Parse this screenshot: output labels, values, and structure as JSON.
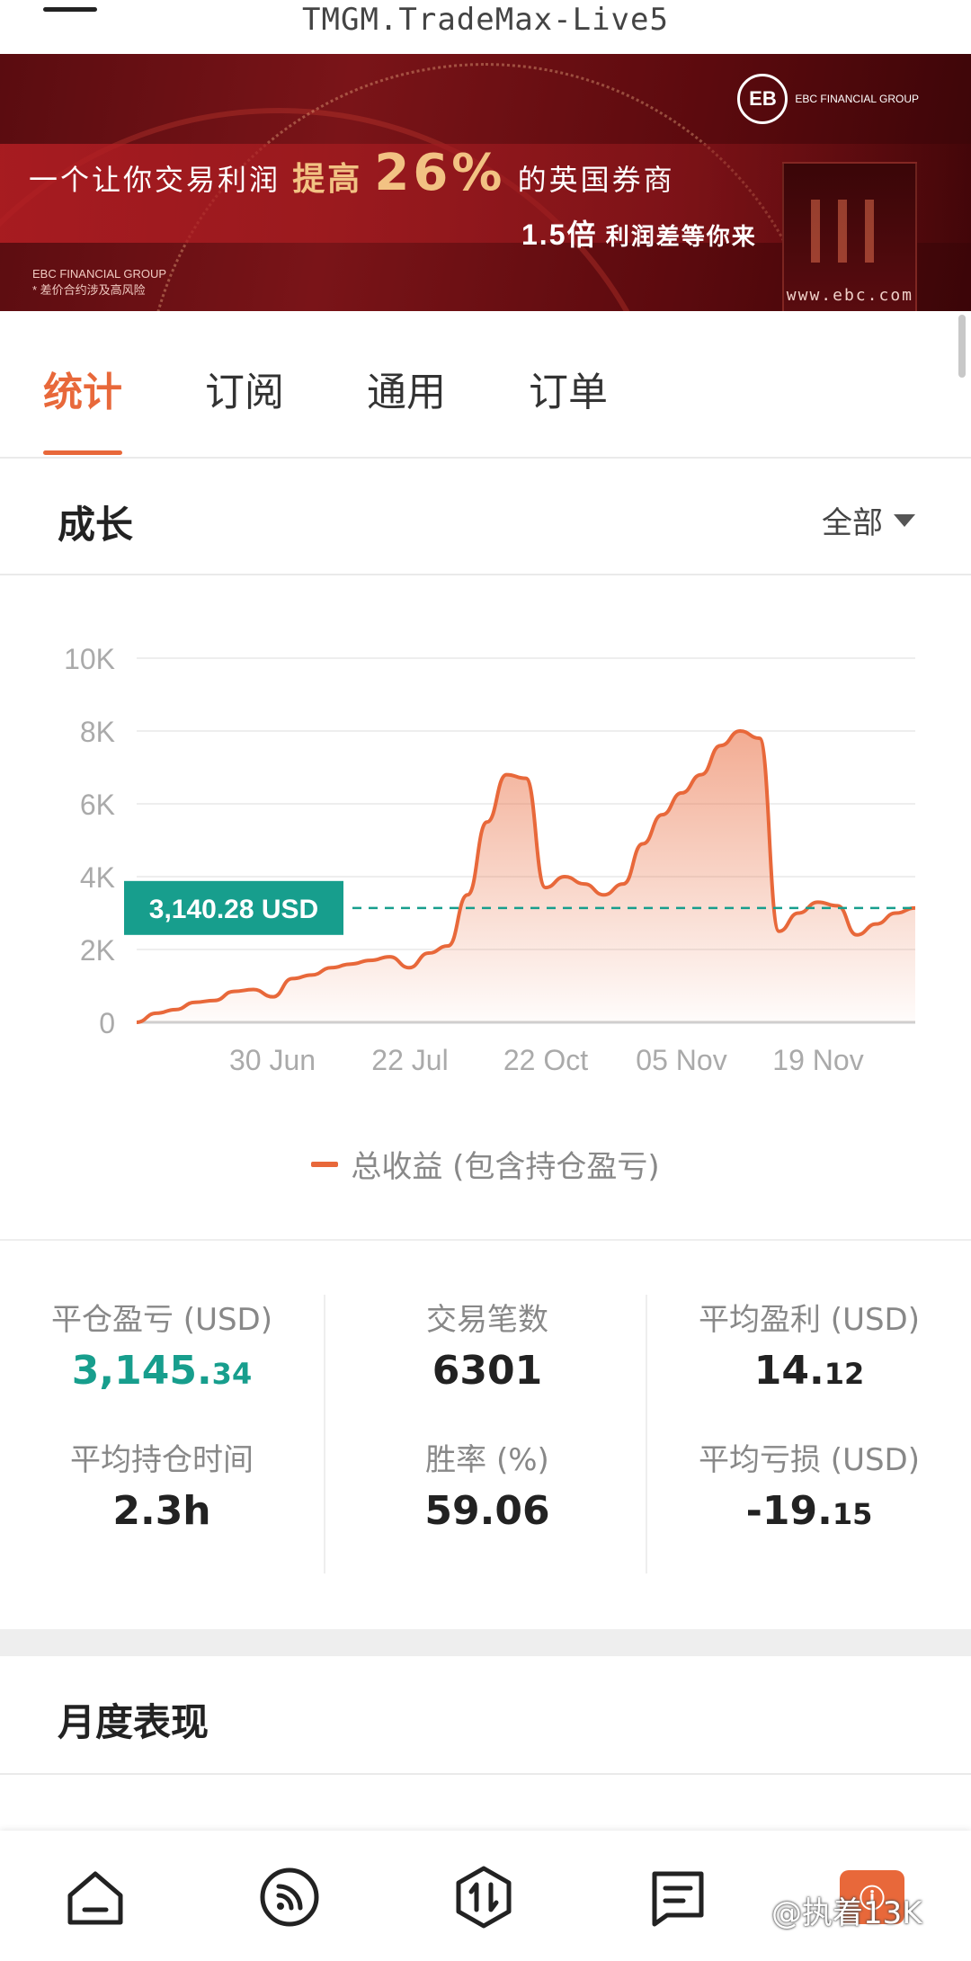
{
  "window": {
    "title": "TMGM.TradeMax-Live5"
  },
  "banner": {
    "headline_pre": "一个让你交易利润",
    "headline_em": "提高",
    "headline_pct": "26%",
    "headline_post": "的英国券商",
    "sub_big": "1.5倍",
    "sub_rest": "利润差等你来",
    "brand_name": "EBC FINANCIAL GROUP",
    "disclaimer": "* 差价合约涉及高风险",
    "logo_text": "EBC FINANCIAL GROUP",
    "url": "www.ebc.com"
  },
  "tabs": [
    {
      "label": "统计",
      "active": true
    },
    {
      "label": "订阅",
      "active": false
    },
    {
      "label": "通用",
      "active": false
    },
    {
      "label": "订单",
      "active": false
    }
  ],
  "growth": {
    "title": "成长",
    "filter_label": "全部"
  },
  "chart_data": {
    "type": "area",
    "y_ticks": [
      "0",
      "2K",
      "4K",
      "6K",
      "8K",
      "10K"
    ],
    "ylim": [
      0,
      10000
    ],
    "x_ticks": [
      "30 Jun",
      "22 Jul",
      "22 Oct",
      "05 Nov",
      "19 Nov"
    ],
    "series": [
      {
        "name": "总收益 (包含持仓盈亏)",
        "color": "#e8683a",
        "values": [
          0,
          250,
          350,
          550,
          600,
          850,
          900,
          700,
          1200,
          1300,
          1500,
          1600,
          1700,
          1800,
          1500,
          1900,
          2100,
          3500,
          5500,
          6800,
          6700,
          3700,
          4000,
          3800,
          3500,
          3800,
          4900,
          5700,
          6300,
          6800,
          7600,
          8000,
          7800,
          2500,
          3000,
          3300,
          3200,
          2400,
          2700,
          3000,
          3140
        ]
      }
    ],
    "current_value_label": "3,140.28 USD",
    "current_value": 3140.28,
    "grid": true
  },
  "stats": {
    "closed_pnl": {
      "label": "平仓盈亏 (USD)",
      "int": "3,145.",
      "dec": "34"
    },
    "trades": {
      "label": "交易笔数",
      "value": "6301"
    },
    "avg_profit": {
      "label": "平均盈利 (USD)",
      "int": "14.",
      "dec": "12"
    },
    "avg_hold": {
      "label": "平均持仓时间",
      "value": "2.3h"
    },
    "win_rate": {
      "label": "胜率 (%)",
      "value": "59.06"
    },
    "avg_loss": {
      "label": "平均亏损 (USD)",
      "int": "-19.",
      "dec": "15"
    }
  },
  "monthly": {
    "title": "月度表现"
  },
  "bottom_nav": {
    "items": [
      "home-icon",
      "feed-icon",
      "trade-icon",
      "orders-icon",
      "profile-icon"
    ],
    "badge_text": "ⓘ"
  },
  "watermark": "@执着13K"
}
